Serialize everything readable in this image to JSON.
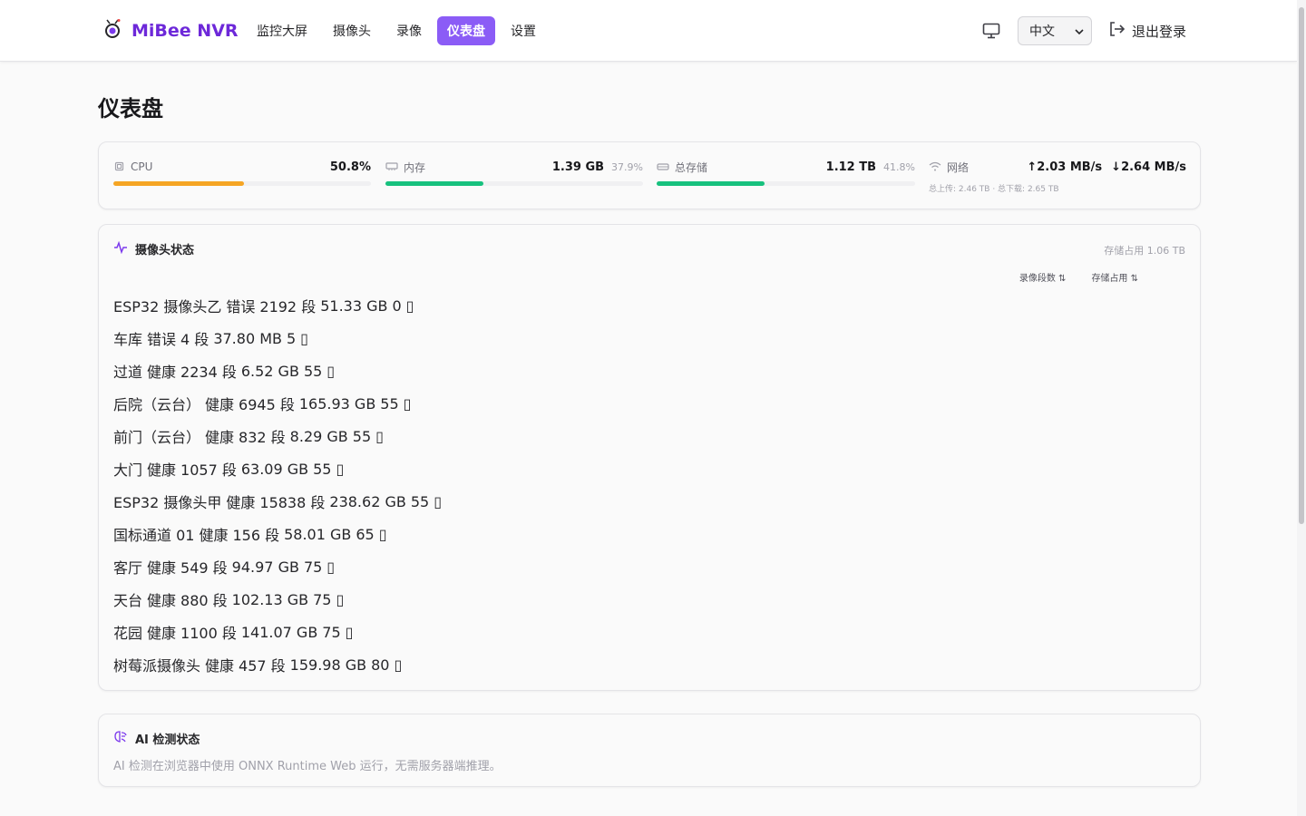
{
  "header": {
    "brand": "MiBee NVR",
    "nav": [
      {
        "label": "监控大屏",
        "active": false
      },
      {
        "label": "摄像头",
        "active": false
      },
      {
        "label": "录像",
        "active": false
      },
      {
        "label": "仪表盘",
        "active": true
      },
      {
        "label": "设置",
        "active": false
      }
    ],
    "display_icon": "monitor-icon",
    "language": "中文",
    "logout_label": "退出登录"
  },
  "page": {
    "title": "仪表盘"
  },
  "stats": {
    "cpu": {
      "label": "CPU",
      "value": "50.8%",
      "fraction": 0.508,
      "color": "#f5a524"
    },
    "memory": {
      "label": "内存",
      "value": "1.39 GB",
      "pct": "37.9%",
      "fraction": 0.379,
      "color": "#17c17e"
    },
    "storage": {
      "label": "总存储",
      "value": "1.12 TB",
      "pct": "41.8%",
      "fraction": 0.418,
      "color": "#17c17e"
    },
    "network": {
      "label": "网络",
      "up": "↑2.03 MB/s",
      "down": "↓2.64 MB/s",
      "summary": "总上传: 2.46 TB · 总下载: 2.65 TB"
    }
  },
  "cameras": {
    "title": "摄像头状态",
    "storage_total": "存储占用 1.06 TB",
    "sort_headers": [
      "录像段数 ⇅",
      "存储占用 ⇅"
    ],
    "rows": [
      {
        "name": "ESP32 摄像头乙",
        "status": "错误",
        "segments": "2192 段",
        "size": "51.33 GB",
        "score": "0",
        "glyph": "▯"
      },
      {
        "name": "车库",
        "status": "错误",
        "segments": "4 段",
        "size": "37.80 MB",
        "score": "5",
        "glyph": "▯"
      },
      {
        "name": "过道",
        "status": "健康",
        "segments": "2234 段",
        "size": "6.52 GB",
        "score": "55",
        "glyph": "▯"
      },
      {
        "name": "后院（云台）",
        "status": "健康",
        "segments": "6945 段",
        "size": "165.93 GB",
        "score": "55",
        "glyph": "▯"
      },
      {
        "name": "前门（云台）",
        "status": "健康",
        "segments": "832 段",
        "size": "8.29 GB",
        "score": "55",
        "glyph": "▯"
      },
      {
        "name": "大门",
        "status": "健康",
        "segments": "1057 段",
        "size": "63.09 GB",
        "score": "55",
        "glyph": "▯"
      },
      {
        "name": "ESP32 摄像头甲",
        "status": "健康",
        "segments": "15838 段",
        "size": "238.62 GB",
        "score": "55",
        "glyph": "▯"
      },
      {
        "name": "国标通道 01",
        "status": "健康",
        "segments": "156 段",
        "size": "58.01 GB",
        "score": "65",
        "glyph": "▯"
      },
      {
        "name": "客厅",
        "status": "健康",
        "segments": "549 段",
        "size": "94.97 GB",
        "score": "75",
        "glyph": "▯"
      },
      {
        "name": "天台",
        "status": "健康",
        "segments": "880 段",
        "size": "102.13 GB",
        "score": "75",
        "glyph": "▯"
      },
      {
        "name": "花园",
        "status": "健康",
        "segments": "1100 段",
        "size": "141.07 GB",
        "score": "75",
        "glyph": "▯"
      },
      {
        "name": "树莓派摄像头",
        "status": "健康",
        "segments": "457 段",
        "size": "159.98 GB",
        "score": "80",
        "glyph": "▯"
      }
    ]
  },
  "ai": {
    "title": "AI 检测状态",
    "description": "AI 检测在浏览器中使用 ONNX Runtime Web 运行，无需服务器端推理。"
  }
}
